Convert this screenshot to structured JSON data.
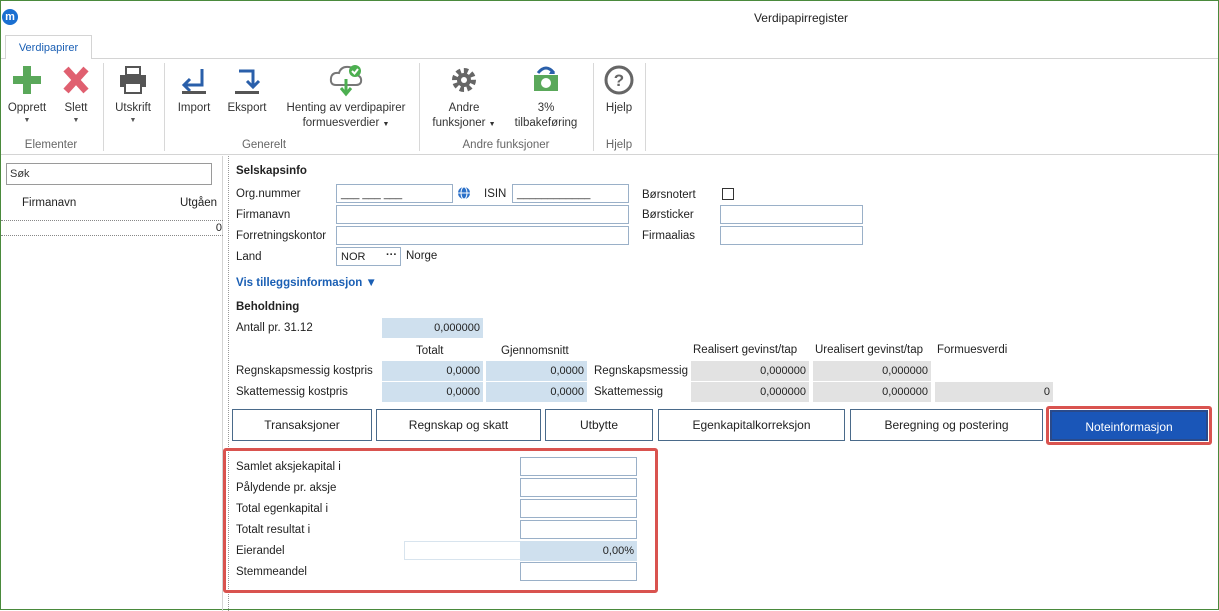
{
  "app": {
    "title": "Verdipapirregister",
    "logo": "m"
  },
  "ribbon_tab": "Verdipapirer",
  "ribbon": {
    "opprett": "Opprett",
    "slett": "Slett",
    "elementer": "Elementer",
    "utskrift": "Utskrift",
    "import": "Import",
    "eksport": "Eksport",
    "henting_l1": "Henting av verdipapirer",
    "henting_l2": "formuesverdier",
    "generelt": "Generelt",
    "andre_l1": "Andre",
    "andre_l2": "funksjoner",
    "tilbake_l1": "3%",
    "tilbake_l2": "tilbakeføring",
    "andre_group": "Andre funksjoner",
    "hjelp": "Hjelp",
    "hjelp_group": "Hjelp"
  },
  "left": {
    "search_placeholder": "Søk",
    "col_firmanavn": "Firmanavn",
    "col_utgaende": "Utgåen",
    "row_value": "0"
  },
  "selskap": {
    "heading": "Selskapsinfo",
    "orgnr_label": "Org.nummer",
    "orgnr_value": "___ ___ ___",
    "isin_label": "ISIN",
    "isin_value": "____________",
    "borsnotert_label": "Børsnotert",
    "firmanavn_label": "Firmanavn",
    "borsticker_label": "Børsticker",
    "forretningskontor_label": "Forretningskontor",
    "firmaalias_label": "Firmaalias",
    "land_label": "Land",
    "land_code": "NOR",
    "land_name": "Norge"
  },
  "vis_tillegg": "Vis tilleggsinformasjon ▼",
  "beholdning": {
    "heading": "Beholdning",
    "antall_label": "Antall pr. 31.12",
    "antall_value": "0,000000",
    "totalt": "Totalt",
    "gjennomsnitt": "Gjennomsnitt",
    "realisert": "Realisert gevinst/tap",
    "urealisert": "Urealisert gevinst/tap",
    "formuesverdi": "Formuesverdi",
    "regnskap_label": "Regnskapsmessig kostpris",
    "skatte_label": "Skattemessig kostpris",
    "regnskap_total": "0,0000",
    "regnskap_snitt": "0,0000",
    "skatte_total": "0,0000",
    "skatte_snitt": "0,0000",
    "regnskapsmessig": "Regnskapsmessig",
    "skattemessig": "Skattemessig",
    "r_realisert": "0,000000",
    "r_urealisert": "0,000000",
    "s_realisert": "0,000000",
    "s_urealisert": "0,000000",
    "s_formue": "0"
  },
  "tabs": [
    "Transaksjoner",
    "Regnskap og skatt",
    "Utbytte",
    "Egenkapitalkorreksjon",
    "Beregning og postering",
    "Noteinformasjon"
  ],
  "note": {
    "samlet": "Samlet aksjekapital i",
    "palydende": "Pålydende pr. aksje",
    "egenkapital": "Total egenkapital i",
    "resultat": "Totalt resultat i",
    "eierandel": "Eierandel",
    "eierandel_value": "0,00%",
    "stemmeandel": "Stemmeandel"
  },
  "colors": {
    "accent": "#1a56b8",
    "highlight": "#d9534f",
    "input_fill": "#cfe0ee"
  }
}
